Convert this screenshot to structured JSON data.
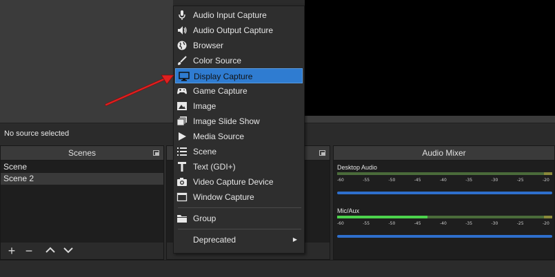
{
  "source_bar": {
    "status": "No source selected"
  },
  "scenes": {
    "title": "Scenes",
    "items": [
      {
        "label": "Scene",
        "selected": false
      },
      {
        "label": "Scene 2",
        "selected": true
      }
    ]
  },
  "mixer": {
    "title": "Audio Mixer",
    "channels": [
      {
        "name": "Desktop Audio",
        "level_fraction": 0.0
      },
      {
        "name": "Mic/Aux",
        "level_fraction": 0.42
      }
    ],
    "ticks": [
      "-60",
      "-55",
      "-50",
      "-45",
      "-40",
      "-35",
      "-30",
      "-25",
      "-20"
    ]
  },
  "menu": {
    "items": [
      {
        "label": "Audio Input Capture",
        "icon": "microphone-icon"
      },
      {
        "label": "Audio Output Capture",
        "icon": "speaker-icon"
      },
      {
        "label": "Browser",
        "icon": "globe-icon"
      },
      {
        "label": "Color Source",
        "icon": "paintbrush-icon"
      },
      {
        "label": "Display Capture",
        "icon": "monitor-icon",
        "highlighted": true
      },
      {
        "label": "Game Capture",
        "icon": "gamepad-icon"
      },
      {
        "label": "Image",
        "icon": "image-icon"
      },
      {
        "label": "Image Slide Show",
        "icon": "slideshow-icon"
      },
      {
        "label": "Media Source",
        "icon": "play-icon"
      },
      {
        "label": "Scene",
        "icon": "list-icon"
      },
      {
        "label": "Text (GDI+)",
        "icon": "text-icon"
      },
      {
        "label": "Video Capture Device",
        "icon": "camera-icon"
      },
      {
        "label": "Window Capture",
        "icon": "window-icon"
      }
    ],
    "group": {
      "label": "Group",
      "icon": "folder-icon"
    },
    "deprecated": {
      "label": "Deprecated",
      "arrow": "▶"
    }
  },
  "colors": {
    "highlight": "#2f7cd1",
    "meter_green": "#4cd34c",
    "fader_blue": "#2e6fcc",
    "annotation_arrow": "#e02020"
  }
}
